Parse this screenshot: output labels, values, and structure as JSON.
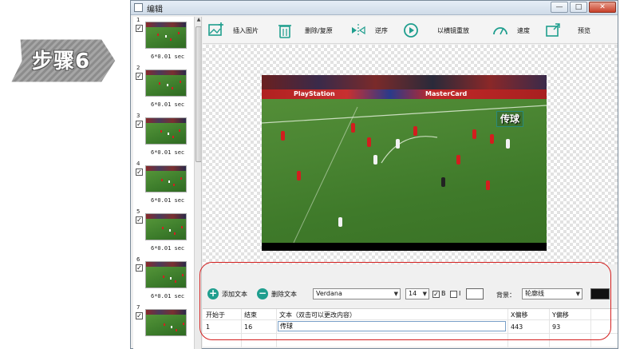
{
  "badge": {
    "label": "步骤6"
  },
  "window": {
    "title": "编辑"
  },
  "window_buttons": {
    "minimize": "—",
    "maximize": "□",
    "close": "✕"
  },
  "toolbar": {
    "insert_image": "插入图片",
    "delete_restore": "删除/复原",
    "reverse": "逆序",
    "mirror_replay": "以横镜重放",
    "speed": "速度",
    "preview": "预览"
  },
  "thumbnails": [
    {
      "num": "1",
      "checked": true,
      "duration": "6*0.01 sec"
    },
    {
      "num": "2",
      "checked": true,
      "duration": "6*0.01 sec"
    },
    {
      "num": "3",
      "checked": true,
      "duration": "6*0.01 sec"
    },
    {
      "num": "4",
      "checked": true,
      "duration": "6*0.01 sec"
    },
    {
      "num": "5",
      "checked": true,
      "duration": "6*0.01 sec"
    },
    {
      "num": "6",
      "checked": true,
      "duration": "6*0.01 sec"
    },
    {
      "num": "7",
      "checked": true,
      "duration": ""
    }
  ],
  "video": {
    "caption": "传球",
    "ads": [
      "PlayStation",
      "MasterCard"
    ]
  },
  "text_panel": {
    "add_text": "添加文本",
    "delete_text": "删除文本",
    "font": "Verdana",
    "font_size": "14",
    "bold_label": "B",
    "italic_label": "I",
    "background_label": "背景：",
    "background_value": "轮廓线"
  },
  "text_table": {
    "columns": [
      "开始于",
      "结束",
      "文本（双击可以更改内容）",
      "X偏移",
      "Y偏移"
    ],
    "rows": [
      {
        "start": "1",
        "end": "16",
        "text": "传球",
        "x_offset": "443",
        "y_offset": "93"
      }
    ]
  },
  "colors": {
    "accent": "#1f9e8e",
    "highlight_outline": "#d42020"
  }
}
